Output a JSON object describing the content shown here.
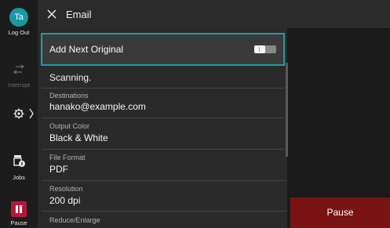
{
  "rail": {
    "user_initials": "Ta",
    "logout_label": "Log Out",
    "interrupt_label": "Interrupt",
    "jobs_label": "Jobs",
    "pause_label": "Pause"
  },
  "header": {
    "title": "Email",
    "close_icon": "close-icon"
  },
  "panel": {
    "toggle": {
      "label": "Add Next Original",
      "state": "off"
    },
    "status": "Scanning.",
    "items": [
      {
        "key": "Destinations",
        "value": "hanako@example.com"
      },
      {
        "key": "Output Color",
        "value": "Black & White"
      },
      {
        "key": "File Format",
        "value": "PDF"
      },
      {
        "key": "Resolution",
        "value": "200 dpi"
      },
      {
        "key": "Reduce/Enlarge",
        "value": ""
      }
    ]
  },
  "actions": {
    "pause_label": "Pause"
  },
  "colors": {
    "accent": "#1f9ea3",
    "pause": "#b5173c",
    "pause_button": "#7a1313"
  }
}
